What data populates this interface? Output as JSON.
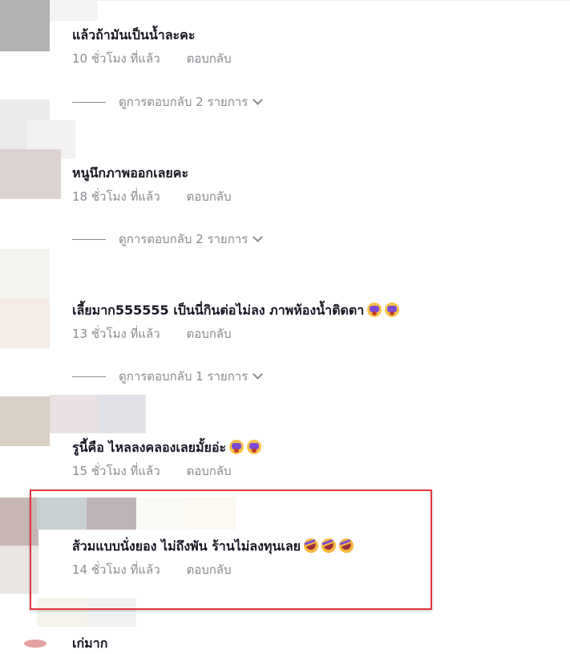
{
  "comments": [
    {
      "text": "แล้วถ้ามันเป็นน้ำละคะ",
      "time": "10 ชั่วโมง ที่แล้ว",
      "reply": "ตอบกลับ",
      "view_replies": "ดูการตอบกลับ 2 รายการ"
    },
    {
      "text": "หนูนึกภาพออกเลยคะ",
      "time": "18 ชั่วโมง ที่แล้ว",
      "reply": "ตอบกลับ",
      "view_replies": "ดูการตอบกลับ 2 รายการ"
    },
    {
      "text": "เลี้ยมาก555555 เป็นนี่กินต่อไม่ลง ภาพห้องน้ำติดตา",
      "time": "13 ชั่วโมง ที่แล้ว",
      "reply": "ตอบกลับ",
      "view_replies": "ดูการตอบกลับ 1 รายการ",
      "emojis": [
        "crying-emoji",
        "crying-emoji"
      ]
    },
    {
      "text": "รูนี้คือ ไหลลงคลองเลยมั้ยอ่ะ",
      "time": "15 ชั่วโมง ที่แล้ว",
      "reply": "ตอบกลับ",
      "emojis": [
        "crying-emoji",
        "crying-emoji"
      ]
    },
    {
      "text": "ส้วมแบบนั่งยอง ไม่ถึงพัน ร้านไม่ลงทุนเลย",
      "time": "14 ชั่วโมง ที่แล้ว",
      "reply": "ตอบกลับ",
      "emojis": [
        "rofl-emoji",
        "rofl-emoji",
        "rofl-emoji"
      ]
    },
    {
      "text": "เก่มาก"
    }
  ],
  "colors": {
    "highlight_border": "#e0393e",
    "meta_text": "#8a8b91",
    "primary_text": "#161823"
  }
}
